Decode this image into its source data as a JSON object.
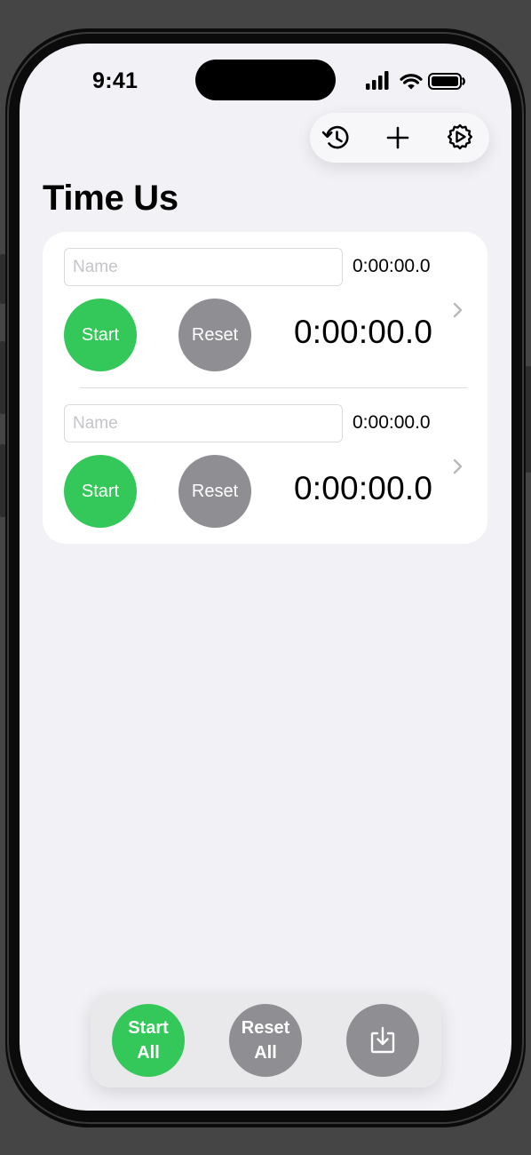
{
  "status_bar": {
    "time": "9:41",
    "icons": [
      "signal-icon",
      "wifi-icon",
      "battery-icon"
    ]
  },
  "toolbar": {
    "items": [
      {
        "name": "history",
        "icon": "history-icon"
      },
      {
        "name": "add",
        "icon": "plus-icon"
      },
      {
        "name": "settings",
        "icon": "gear-play-icon"
      }
    ]
  },
  "page_title": "Time Us",
  "timers": [
    {
      "name_value": "",
      "name_placeholder": "Name",
      "lap_time": "0:00:00.0",
      "start_label": "Start",
      "reset_label": "Reset",
      "elapsed": "0:00:00.0"
    },
    {
      "name_value": "",
      "name_placeholder": "Name",
      "lap_time": "0:00:00.0",
      "start_label": "Start",
      "reset_label": "Reset",
      "elapsed": "0:00:00.0"
    }
  ],
  "bottom_bar": {
    "start_all_line1": "Start",
    "start_all_line2": "All",
    "reset_all_line1": "Reset",
    "reset_all_line2": "All",
    "export_icon": "download-tray-icon"
  },
  "colors": {
    "start_green": "#34c759",
    "reset_gray": "#8e8e93",
    "background": "#f1f1f6"
  }
}
